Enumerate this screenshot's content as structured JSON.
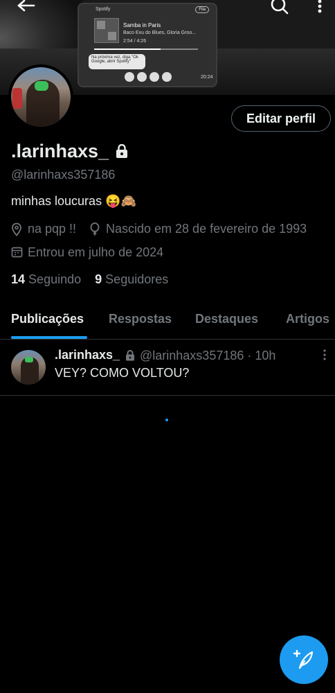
{
  "banner": {
    "app_label": "Spotify",
    "song_title": "Samba in Paris",
    "artists": "Baco Exu do Blues, Gloria Groo...",
    "time": "2:54 / 4:26",
    "assistant_hint": "Na próxima vez, diga \"Ok Google, abrir Spotify\"",
    "chip_label": "Fila",
    "clock": "20:24"
  },
  "profile": {
    "display_name": ".larinhaxs_",
    "handle": "@larinhaxs357186",
    "bio": "minhas loucuras 😝🙈",
    "location": "na pqp !!",
    "birthday": "Nascido em 28 de fevereiro de 1993",
    "joined": "Entrou em julho de 2024",
    "following_count": "14",
    "following_label": "Seguindo",
    "followers_count": "9",
    "followers_label": "Seguidores",
    "edit_button": "Editar perfil"
  },
  "tabs": [
    "Publicações",
    "Respostas",
    "Destaques",
    "Artigos"
  ],
  "active_tab": "Publicações",
  "post": {
    "author": ".larinhaxs_",
    "meta": "@larinhaxs357186 · 10h",
    "text": "VEY? COMO VOLTOU?"
  },
  "colors": {
    "accent": "#1d9bf0",
    "background": "#000000",
    "secondary_text": "#71767b",
    "divider": "#2f3336"
  },
  "icons": [
    "back-arrow-icon",
    "search-icon",
    "more-vertical-icon",
    "lock-icon",
    "location-icon",
    "balloon-icon",
    "calendar-icon",
    "compose-post-icon"
  ]
}
